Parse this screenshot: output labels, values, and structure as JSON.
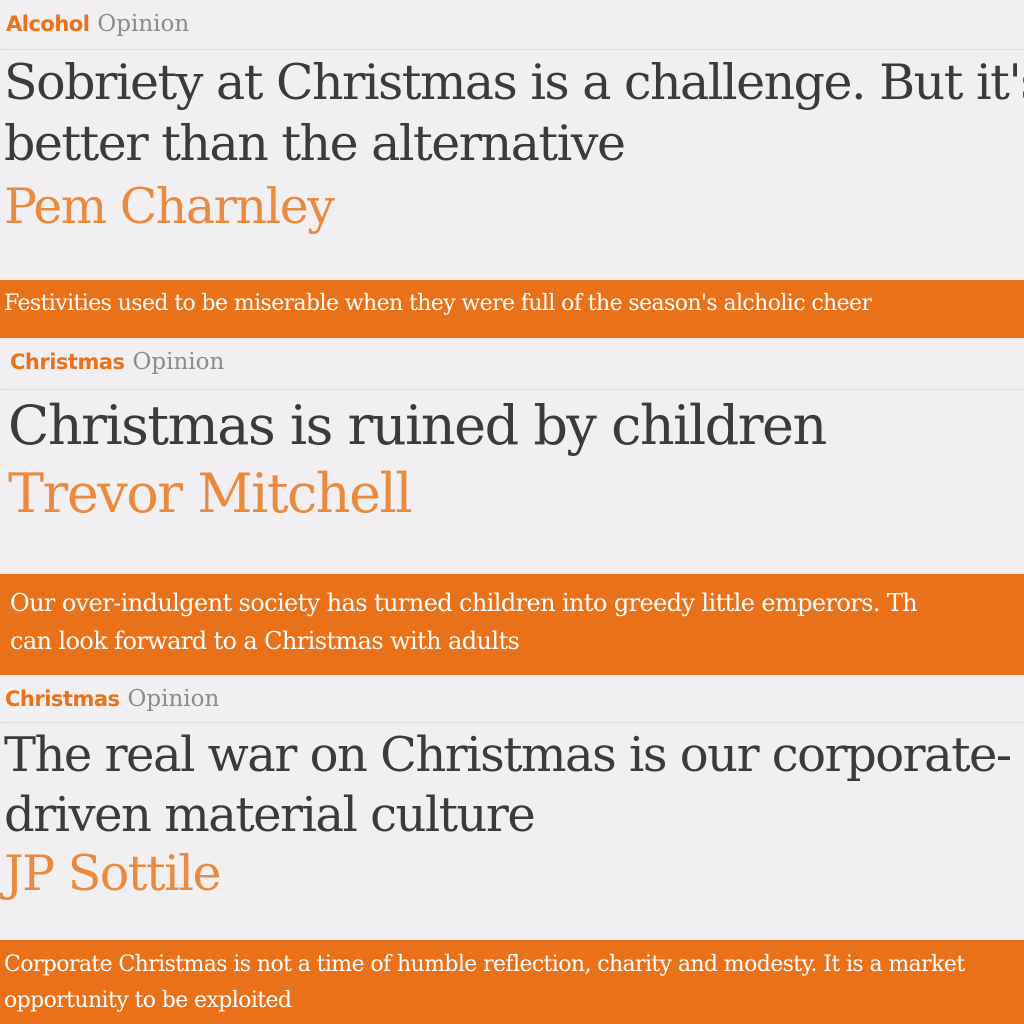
{
  "articles": [
    {
      "section": "Alcohol",
      "tone": "Opinion",
      "headline_lines": [
        "Sobriety at Christmas is a challenge. But it's",
        "better than the alternative"
      ],
      "author": "Pem Charnley",
      "standfirst_lines": [
        "Festivities used to be miserable when they were full of the season's alcholic cheer"
      ]
    },
    {
      "section": "Christmas",
      "tone": "Opinion",
      "headline_lines": [
        "Christmas is ruined by children"
      ],
      "author": "Trevor Mitchell",
      "standfirst_lines": [
        "Our over-indulgent society has turned children into greedy little emperors. Th",
        "can look forward to a Christmas with adults"
      ]
    },
    {
      "section": "Christmas",
      "tone": "Opinion",
      "headline_lines": [
        "The real war on Christmas is our corporate-",
        "driven material culture"
      ],
      "author": "JP Sottile",
      "standfirst_lines": [
        "Corporate Christmas is not a time of humble reflection, charity and modesty. It is a market",
        "opportunity to be exploited"
      ]
    }
  ],
  "colors": {
    "accent": "#e8711a",
    "byline": "#ea8a3e",
    "headline": "#3b3b3b",
    "background": "#f1eff2",
    "muted": "#8c8c8c"
  }
}
